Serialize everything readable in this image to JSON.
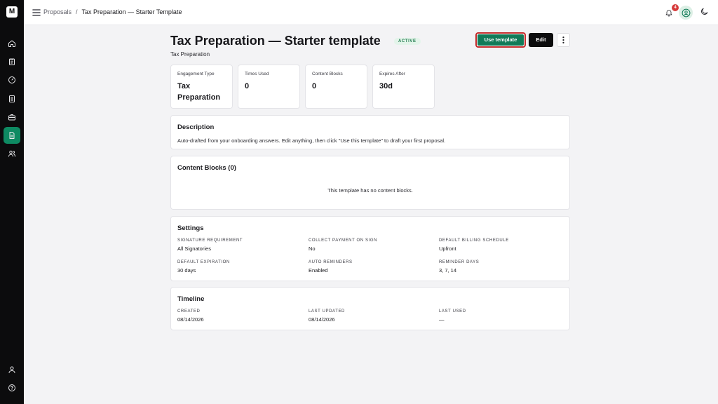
{
  "rail": {
    "logo": "M",
    "items": [
      {
        "icon": "home-icon"
      },
      {
        "icon": "clipboard-icon"
      },
      {
        "icon": "gauge-icon"
      },
      {
        "icon": "list-document-icon"
      },
      {
        "icon": "briefcase-icon"
      },
      {
        "icon": "proposal-document-icon",
        "active": true
      },
      {
        "icon": "users-icon"
      }
    ],
    "bottom": [
      {
        "icon": "user-icon"
      },
      {
        "icon": "help-icon"
      }
    ]
  },
  "header": {
    "breadcrumb_root": "Proposals",
    "breadcrumb_sep": "/",
    "breadcrumb_current": "Tax Preparation — Starter Template",
    "notification_count": "4"
  },
  "page": {
    "title": "Tax Preparation — Starter template",
    "status": "ACTIVE",
    "subtitle": "Tax Preparation",
    "use_template_label": "Use template",
    "edit_label": "Edit"
  },
  "stats": [
    {
      "label": "Engagement Type",
      "value": "Tax Preparation"
    },
    {
      "label": "Times Used",
      "value": "0"
    },
    {
      "label": "Content Blocks",
      "value": "0"
    },
    {
      "label": "Expires After",
      "value": "30d"
    }
  ],
  "description": {
    "heading": "Description",
    "text": "Auto-drafted from your onboarding answers. Edit anything, then click \"Use this template\" to draft your first proposal."
  },
  "content_blocks": {
    "heading": "Content Blocks (0)",
    "empty": "This template has no content blocks."
  },
  "settings": {
    "heading": "Settings",
    "items": [
      {
        "label": "Signature Requirement",
        "value": "All Signatories"
      },
      {
        "label": "Collect Payment on Sign",
        "value": "No"
      },
      {
        "label": "Default Billing Schedule",
        "value": "Upfront"
      },
      {
        "label": "Default Expiration",
        "value": "30 days"
      },
      {
        "label": "Auto Reminders",
        "value": "Enabled"
      },
      {
        "label": "Reminder Days",
        "value": "3, 7, 14"
      }
    ]
  },
  "timeline": {
    "heading": "Timeline",
    "items": [
      {
        "label": "Created",
        "value": "08/14/2026"
      },
      {
        "label": "Last Updated",
        "value": "08/14/2026"
      },
      {
        "label": "Last Used",
        "value": "—"
      }
    ]
  },
  "colors": {
    "accent": "#117a58",
    "rail": "#0c0c0d",
    "badge": "#d63a3a"
  }
}
